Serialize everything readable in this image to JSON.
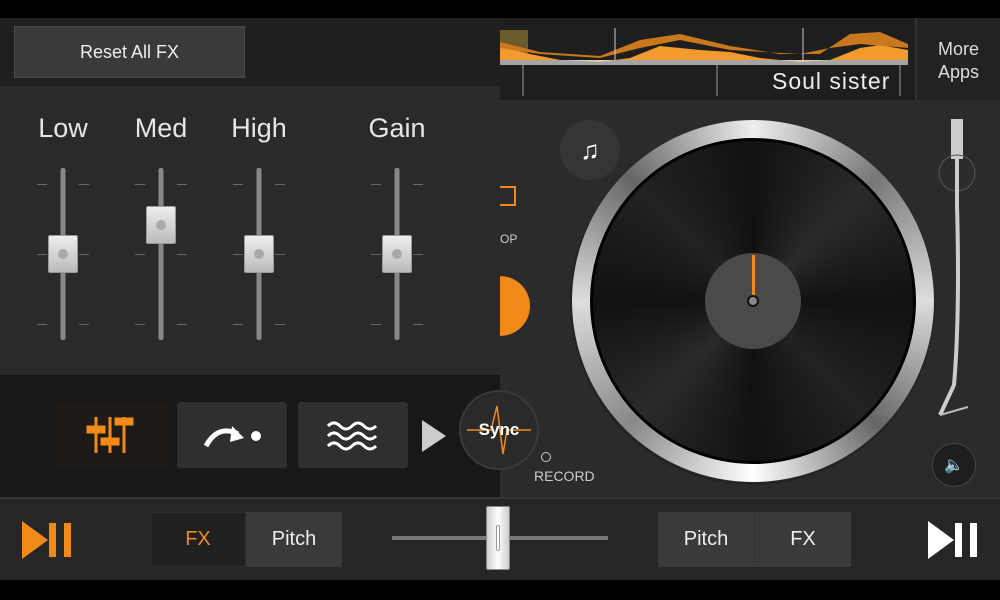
{
  "fx_panel": {
    "reset_label": "Reset All FX",
    "eq_sliders": [
      {
        "label": "Low",
        "value": 0.5
      },
      {
        "label": "Med",
        "value": 0.67
      },
      {
        "label": "High",
        "value": 0.5
      },
      {
        "label": "Gain",
        "value": 0.5
      }
    ],
    "fx_buttons": [
      {
        "icon": "equalizer-icon",
        "active": true
      },
      {
        "icon": "loop-arrow-icon",
        "active": false
      },
      {
        "icon": "waves-icon",
        "active": false
      }
    ],
    "expand_icon": "play-triangle-icon"
  },
  "deck": {
    "track_title": "Soul sister",
    "more_apps_line1": "More",
    "more_apps_line2": "Apps",
    "loop_label_partial": "OP",
    "sync_label": "Sync",
    "record_label": "RECORD",
    "add_music_icon": "add-music-icon",
    "volume_icon": "speaker-icon"
  },
  "bottom_bar": {
    "left": {
      "fx": "FX",
      "pitch": "Pitch",
      "selected": "FX"
    },
    "right": {
      "pitch": "Pitch",
      "fx": "FX",
      "selected": "Pitch"
    },
    "crossfader_value": 0.49
  },
  "colors": {
    "accent": "#f28a1a",
    "background": "#262626"
  }
}
